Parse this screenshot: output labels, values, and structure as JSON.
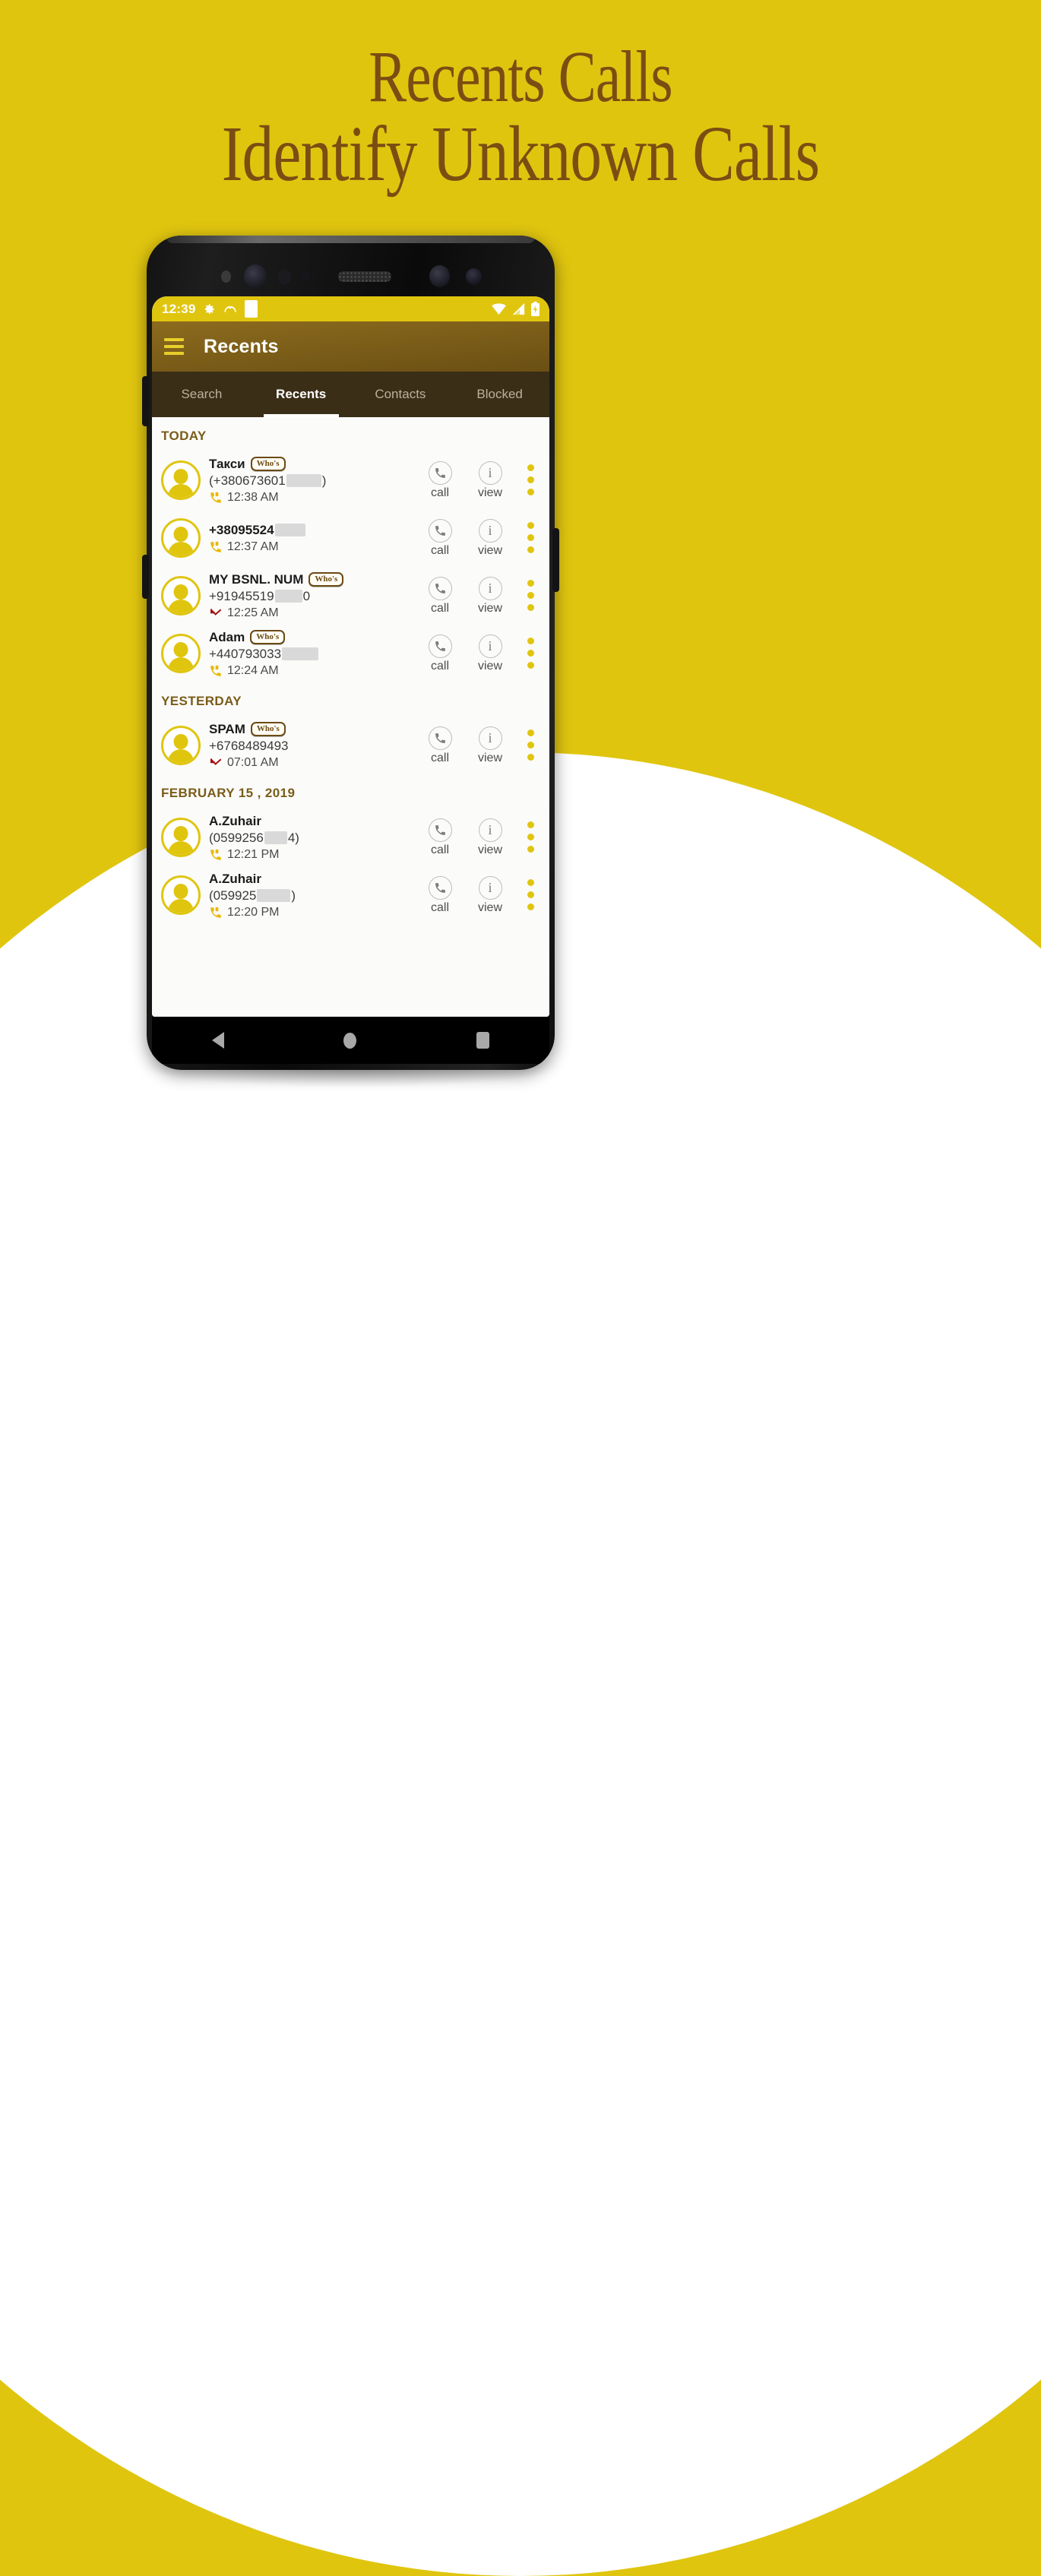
{
  "headline": {
    "line1": "Recents Calls",
    "line2": "Identify Unknown Calls"
  },
  "colors": {
    "brand_yellow": "#E0C50F",
    "brand_brown": "#7A5C18",
    "headline_brown": "#7A4E12",
    "tabs_dark": "#3B2E17",
    "missed_red": "#A3100F"
  },
  "phone": {
    "statusbar": {
      "time": "12:39",
      "icons_left": [
        "gear-icon",
        "missed-call-icon",
        "white-notification-icon"
      ],
      "icons_right": [
        "wifi-icon",
        "signal-icon",
        "battery-icon"
      ]
    },
    "appbar": {
      "menu_icon": "hamburger-menu-icon",
      "title": "Recents"
    },
    "tabs": [
      {
        "label": "Search",
        "active": false
      },
      {
        "label": "Recents",
        "active": true
      },
      {
        "label": "Contacts",
        "active": false
      },
      {
        "label": "Blocked",
        "active": false
      }
    ],
    "actions": {
      "call_label": "call",
      "view_label": "view",
      "call_icon": "phone-handset-icon",
      "view_icon": "info-icon",
      "overflow_icon": "kebab-menu-icon"
    },
    "badge_text": "Who's",
    "sections": [
      {
        "title": "TODAY",
        "rows": [
          {
            "name": "Такси",
            "badge": true,
            "number_prefix": "(+380673601",
            "number_suffix": ")",
            "redacted_width": 46,
            "time": "12:38 AM",
            "direction": "outgoing"
          },
          {
            "name": "+38095524",
            "badge": false,
            "number_prefix": "",
            "number_suffix": "",
            "redacted_width": 0,
            "time": "12:37 AM",
            "direction": "outgoing",
            "name_redacted_width": 40
          },
          {
            "name": "MY BSNL. NUM",
            "badge": true,
            "number_prefix": "+91945519",
            "number_suffix": "0",
            "redacted_width": 36,
            "time": "12:25 AM",
            "direction": "missed"
          },
          {
            "name": "Adam",
            "badge": true,
            "number_prefix": "+440793033",
            "number_suffix": "",
            "redacted_width": 48,
            "time": "12:24 AM",
            "direction": "outgoing"
          }
        ]
      },
      {
        "title": "YESTERDAY",
        "rows": [
          {
            "name": "SPAM",
            "badge": true,
            "number_prefix": "+6768489493",
            "number_suffix": "",
            "redacted_width": 0,
            "time": "07:01 AM",
            "direction": "missed"
          }
        ]
      },
      {
        "title": "FEBRUARY 15 , 2019",
        "rows": [
          {
            "name": "A.Zuhair",
            "badge": false,
            "number_prefix": "(0599256",
            "number_suffix": "4)",
            "redacted_width": 30,
            "time": "12:21 PM",
            "direction": "outgoing"
          },
          {
            "name": "A.Zuhair",
            "badge": false,
            "number_prefix": "(059925",
            "number_suffix": ")",
            "redacted_width": 44,
            "time": "12:20 PM",
            "direction": "outgoing"
          }
        ]
      }
    ],
    "navbar": {
      "back": "back-nav-icon",
      "home": "home-nav-icon",
      "recents": "recents-nav-icon"
    }
  }
}
